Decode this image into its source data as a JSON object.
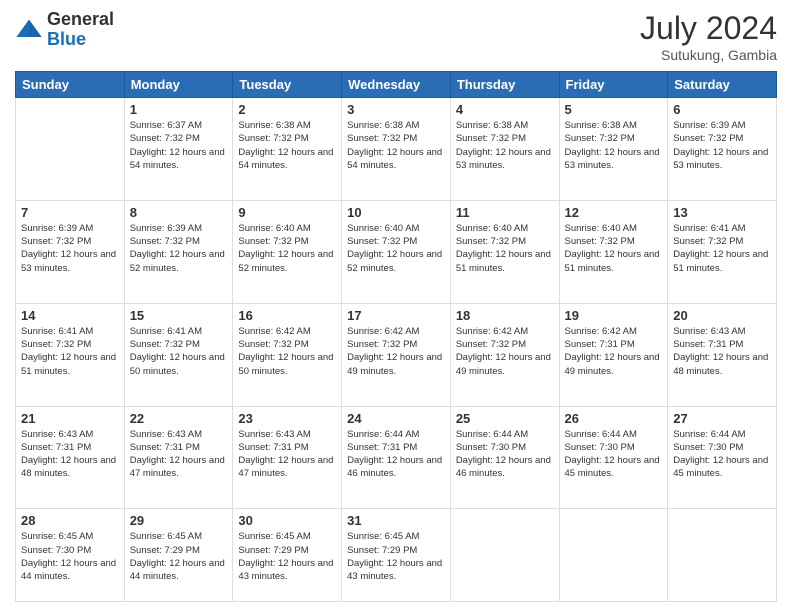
{
  "logo": {
    "general": "General",
    "blue": "Blue"
  },
  "header": {
    "month_year": "July 2024",
    "location": "Sutukung, Gambia"
  },
  "days_of_week": [
    "Sunday",
    "Monday",
    "Tuesday",
    "Wednesday",
    "Thursday",
    "Friday",
    "Saturday"
  ],
  "weeks": [
    [
      {
        "day": "",
        "sunrise": "",
        "sunset": "",
        "daylight": ""
      },
      {
        "day": "1",
        "sunrise": "Sunrise: 6:37 AM",
        "sunset": "Sunset: 7:32 PM",
        "daylight": "Daylight: 12 hours and 54 minutes."
      },
      {
        "day": "2",
        "sunrise": "Sunrise: 6:38 AM",
        "sunset": "Sunset: 7:32 PM",
        "daylight": "Daylight: 12 hours and 54 minutes."
      },
      {
        "day": "3",
        "sunrise": "Sunrise: 6:38 AM",
        "sunset": "Sunset: 7:32 PM",
        "daylight": "Daylight: 12 hours and 54 minutes."
      },
      {
        "day": "4",
        "sunrise": "Sunrise: 6:38 AM",
        "sunset": "Sunset: 7:32 PM",
        "daylight": "Daylight: 12 hours and 53 minutes."
      },
      {
        "day": "5",
        "sunrise": "Sunrise: 6:38 AM",
        "sunset": "Sunset: 7:32 PM",
        "daylight": "Daylight: 12 hours and 53 minutes."
      },
      {
        "day": "6",
        "sunrise": "Sunrise: 6:39 AM",
        "sunset": "Sunset: 7:32 PM",
        "daylight": "Daylight: 12 hours and 53 minutes."
      }
    ],
    [
      {
        "day": "7",
        "sunrise": "Sunrise: 6:39 AM",
        "sunset": "Sunset: 7:32 PM",
        "daylight": "Daylight: 12 hours and 53 minutes."
      },
      {
        "day": "8",
        "sunrise": "Sunrise: 6:39 AM",
        "sunset": "Sunset: 7:32 PM",
        "daylight": "Daylight: 12 hours and 52 minutes."
      },
      {
        "day": "9",
        "sunrise": "Sunrise: 6:40 AM",
        "sunset": "Sunset: 7:32 PM",
        "daylight": "Daylight: 12 hours and 52 minutes."
      },
      {
        "day": "10",
        "sunrise": "Sunrise: 6:40 AM",
        "sunset": "Sunset: 7:32 PM",
        "daylight": "Daylight: 12 hours and 52 minutes."
      },
      {
        "day": "11",
        "sunrise": "Sunrise: 6:40 AM",
        "sunset": "Sunset: 7:32 PM",
        "daylight": "Daylight: 12 hours and 51 minutes."
      },
      {
        "day": "12",
        "sunrise": "Sunrise: 6:40 AM",
        "sunset": "Sunset: 7:32 PM",
        "daylight": "Daylight: 12 hours and 51 minutes."
      },
      {
        "day": "13",
        "sunrise": "Sunrise: 6:41 AM",
        "sunset": "Sunset: 7:32 PM",
        "daylight": "Daylight: 12 hours and 51 minutes."
      }
    ],
    [
      {
        "day": "14",
        "sunrise": "Sunrise: 6:41 AM",
        "sunset": "Sunset: 7:32 PM",
        "daylight": "Daylight: 12 hours and 51 minutes."
      },
      {
        "day": "15",
        "sunrise": "Sunrise: 6:41 AM",
        "sunset": "Sunset: 7:32 PM",
        "daylight": "Daylight: 12 hours and 50 minutes."
      },
      {
        "day": "16",
        "sunrise": "Sunrise: 6:42 AM",
        "sunset": "Sunset: 7:32 PM",
        "daylight": "Daylight: 12 hours and 50 minutes."
      },
      {
        "day": "17",
        "sunrise": "Sunrise: 6:42 AM",
        "sunset": "Sunset: 7:32 PM",
        "daylight": "Daylight: 12 hours and 49 minutes."
      },
      {
        "day": "18",
        "sunrise": "Sunrise: 6:42 AM",
        "sunset": "Sunset: 7:32 PM",
        "daylight": "Daylight: 12 hours and 49 minutes."
      },
      {
        "day": "19",
        "sunrise": "Sunrise: 6:42 AM",
        "sunset": "Sunset: 7:31 PM",
        "daylight": "Daylight: 12 hours and 49 minutes."
      },
      {
        "day": "20",
        "sunrise": "Sunrise: 6:43 AM",
        "sunset": "Sunset: 7:31 PM",
        "daylight": "Daylight: 12 hours and 48 minutes."
      }
    ],
    [
      {
        "day": "21",
        "sunrise": "Sunrise: 6:43 AM",
        "sunset": "Sunset: 7:31 PM",
        "daylight": "Daylight: 12 hours and 48 minutes."
      },
      {
        "day": "22",
        "sunrise": "Sunrise: 6:43 AM",
        "sunset": "Sunset: 7:31 PM",
        "daylight": "Daylight: 12 hours and 47 minutes."
      },
      {
        "day": "23",
        "sunrise": "Sunrise: 6:43 AM",
        "sunset": "Sunset: 7:31 PM",
        "daylight": "Daylight: 12 hours and 47 minutes."
      },
      {
        "day": "24",
        "sunrise": "Sunrise: 6:44 AM",
        "sunset": "Sunset: 7:31 PM",
        "daylight": "Daylight: 12 hours and 46 minutes."
      },
      {
        "day": "25",
        "sunrise": "Sunrise: 6:44 AM",
        "sunset": "Sunset: 7:30 PM",
        "daylight": "Daylight: 12 hours and 46 minutes."
      },
      {
        "day": "26",
        "sunrise": "Sunrise: 6:44 AM",
        "sunset": "Sunset: 7:30 PM",
        "daylight": "Daylight: 12 hours and 45 minutes."
      },
      {
        "day": "27",
        "sunrise": "Sunrise: 6:44 AM",
        "sunset": "Sunset: 7:30 PM",
        "daylight": "Daylight: 12 hours and 45 minutes."
      }
    ],
    [
      {
        "day": "28",
        "sunrise": "Sunrise: 6:45 AM",
        "sunset": "Sunset: 7:30 PM",
        "daylight": "Daylight: 12 hours and 44 minutes."
      },
      {
        "day": "29",
        "sunrise": "Sunrise: 6:45 AM",
        "sunset": "Sunset: 7:29 PM",
        "daylight": "Daylight: 12 hours and 44 minutes."
      },
      {
        "day": "30",
        "sunrise": "Sunrise: 6:45 AM",
        "sunset": "Sunset: 7:29 PM",
        "daylight": "Daylight: 12 hours and 43 minutes."
      },
      {
        "day": "31",
        "sunrise": "Sunrise: 6:45 AM",
        "sunset": "Sunset: 7:29 PM",
        "daylight": "Daylight: 12 hours and 43 minutes."
      },
      {
        "day": "",
        "sunrise": "",
        "sunset": "",
        "daylight": ""
      },
      {
        "day": "",
        "sunrise": "",
        "sunset": "",
        "daylight": ""
      },
      {
        "day": "",
        "sunrise": "",
        "sunset": "",
        "daylight": ""
      }
    ]
  ]
}
